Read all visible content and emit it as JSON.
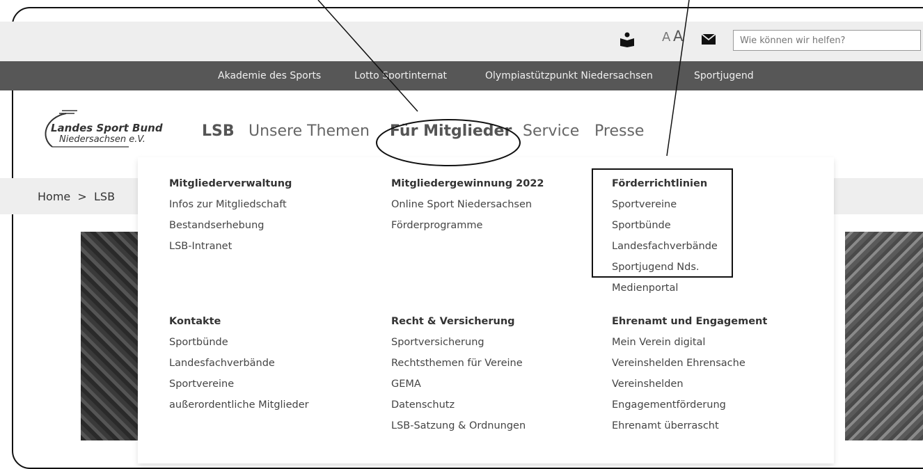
{
  "utility": {
    "font_small": "A",
    "font_large": "A",
    "search_placeholder": "Wie können wir helfen?"
  },
  "top_nav": [
    "Akademie des Sports",
    "Lotto Sportinternat",
    "Olympiastützpunkt Niedersachsen",
    "Sportjugend"
  ],
  "logo": {
    "line1": "Landes Sport Bund",
    "line2": "Niedersachsen e.V."
  },
  "main_nav": [
    "LSB",
    "Unsere Themen",
    "Für Mitglieder",
    "Service",
    "Presse"
  ],
  "breadcrumb": "Home  >  LSB",
  "menu": {
    "col1": {
      "sec1": {
        "head": "Mitgliederverwaltung",
        "items": [
          "Infos zur Mitgliedschaft",
          "Bestandserhebung",
          "LSB-Intranet"
        ]
      },
      "sec2": {
        "head": "Kontakte",
        "items": [
          "Sportbünde",
          "Landesfachverbände",
          "Sportvereine",
          "außerordentliche Mitglieder"
        ]
      }
    },
    "col2": {
      "sec1": {
        "head": "Mitgliedergewinnung 2022",
        "items": [
          "Online Sport Niedersachsen",
          "Förderprogramme"
        ]
      },
      "sec2": {
        "head": "Recht & Versicherung",
        "items": [
          "Sportversicherung",
          "Rechtsthemen für Vereine",
          "GEMA",
          "Datenschutz",
          "LSB-Satzung & Ordnungen"
        ]
      }
    },
    "col3": {
      "sec1": {
        "head": "Förderrichtlinien",
        "items": [
          "Sportvereine",
          "Sportbünde",
          "Landesfachverbände",
          "Sportjugend Nds.",
          "Medienportal"
        ]
      },
      "sec2": {
        "head": "Ehrenamt und Engagement",
        "items": [
          "Mein Verein digital",
          "Vereinshelden Ehrensache",
          "Vereinshelden",
          "Engagementförderung",
          "Ehrenamt überrascht"
        ]
      }
    }
  },
  "icons": [
    "library-icon",
    "mail-icon"
  ]
}
